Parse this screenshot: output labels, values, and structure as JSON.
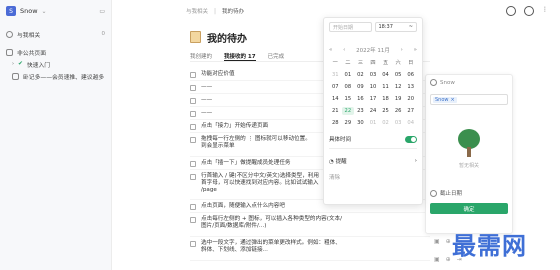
{
  "sidebar": {
    "user": "Snow",
    "items": [
      {
        "label": "与我相关",
        "count": "0"
      },
      {
        "label": "非公共页面"
      },
      {
        "label": "快速入门"
      },
      {
        "label": "卧记多——会员速推、建议越多"
      }
    ]
  },
  "topbar": {
    "crumbs": [
      "与我相关",
      "我的待办"
    ]
  },
  "main": {
    "title": "我的待办",
    "tabs": [
      "我创建的",
      "我接收的 17",
      "已完成"
    ],
    "tasks": [
      "功能对应价值",
      "——",
      "——",
      "——",
      "点击「接力」开始传递页面",
      "拖拽每一行左侧的 ⋮ 图标就可以移动位置。\n到会显示菜单",
      "点击「插一下」做提醒成员处理任务",
      "行首输入 / 键(不区分中文/英文)选择类型，利用\n首字母，可以快速找到对应内容。比如试试输入\n/page",
      "点击页面，随便输入点什么内容吧",
      "点击每行左侧的 + 图标，可以插入各种类型的内容(文本/\n图片/页面/数据库/附件/...)",
      "选中一段文字，通过弹出的菜单更改样式。例如：粗体、\n斜体、下划线、添加链接..."
    ]
  },
  "popover": {
    "start_placeholder": "开始日期",
    "time": "18:37",
    "time_sep": "~",
    "month_label": "2022年  11月",
    "weekdays": [
      "一",
      "二",
      "三",
      "四",
      "五",
      "六",
      "日"
    ],
    "days": [
      [
        "31",
        "01",
        "02",
        "03",
        "04",
        "05",
        "06"
      ],
      [
        "07",
        "08",
        "09",
        "10",
        "11",
        "12",
        "13"
      ],
      [
        "14",
        "15",
        "16",
        "17",
        "18",
        "19",
        "20"
      ],
      [
        "21",
        "22",
        "23",
        "24",
        "25",
        "26",
        "27"
      ],
      [
        "28",
        "29",
        "30",
        "01",
        "02",
        "03",
        "04"
      ]
    ],
    "specific_time_label": "具体时间",
    "reminder_label": "提醒",
    "clear_label": "清除"
  },
  "right_panel": {
    "user": "Snow",
    "tag": "Snow",
    "empty_text": "暂无相关",
    "deadline_label": "截止日期",
    "confirm_label": "确定"
  },
  "watermark": "最需网"
}
